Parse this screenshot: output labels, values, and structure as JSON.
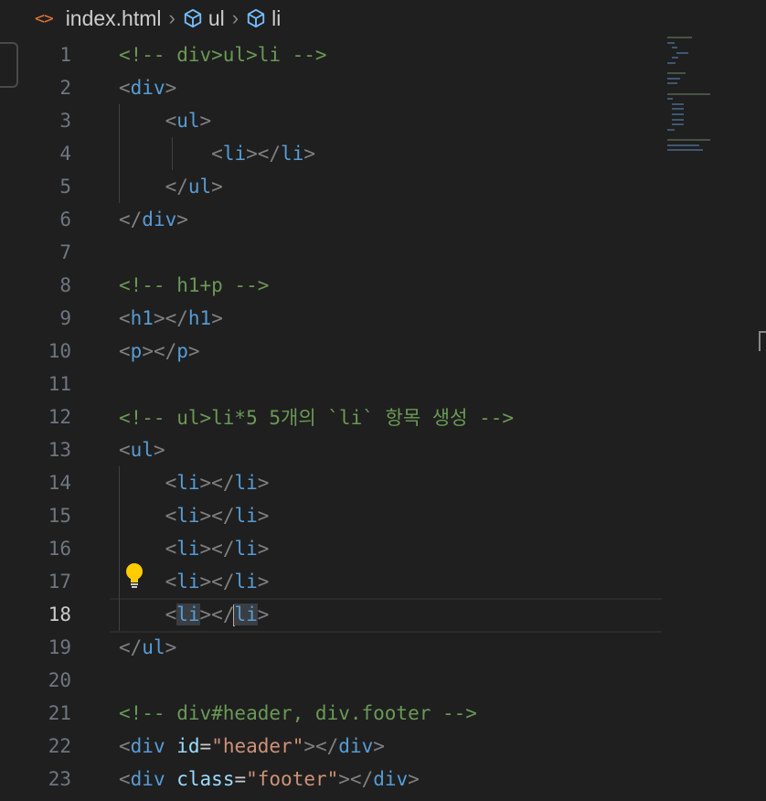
{
  "breadcrumb": {
    "file_icon": "<>",
    "file": "index.html",
    "items": [
      "ul",
      "li"
    ]
  },
  "editor": {
    "active_line": 18,
    "lines": [
      {
        "n": "1",
        "tokens": [
          [
            "cmt",
            "<!-- div>ul>li -->"
          ]
        ]
      },
      {
        "n": "2",
        "tokens": [
          [
            "br",
            "<"
          ],
          [
            "tag",
            "div"
          ],
          [
            "br",
            ">"
          ]
        ]
      },
      {
        "n": "3",
        "tokens": [
          [
            "sp",
            "    "
          ],
          [
            "br",
            "<"
          ],
          [
            "tag",
            "ul"
          ],
          [
            "br",
            ">"
          ]
        ]
      },
      {
        "n": "4",
        "tokens": [
          [
            "sp",
            "        "
          ],
          [
            "br",
            "<"
          ],
          [
            "tag",
            "li"
          ],
          [
            "br",
            "></"
          ],
          [
            "tag",
            "li"
          ],
          [
            "br",
            ">"
          ]
        ]
      },
      {
        "n": "5",
        "tokens": [
          [
            "sp",
            "    "
          ],
          [
            "br",
            "</"
          ],
          [
            "tag",
            "ul"
          ],
          [
            "br",
            ">"
          ]
        ]
      },
      {
        "n": "6",
        "tokens": [
          [
            "br",
            "</"
          ],
          [
            "tag",
            "div"
          ],
          [
            "br",
            ">"
          ]
        ]
      },
      {
        "n": "7",
        "tokens": []
      },
      {
        "n": "8",
        "tokens": [
          [
            "cmt",
            "<!-- h1+p -->"
          ]
        ]
      },
      {
        "n": "9",
        "tokens": [
          [
            "br",
            "<"
          ],
          [
            "tag",
            "h1"
          ],
          [
            "br",
            "></"
          ],
          [
            "tag",
            "h1"
          ],
          [
            "br",
            ">"
          ]
        ]
      },
      {
        "n": "10",
        "tokens": [
          [
            "br",
            "<"
          ],
          [
            "tag",
            "p"
          ],
          [
            "br",
            "></"
          ],
          [
            "tag",
            "p"
          ],
          [
            "br",
            ">"
          ]
        ]
      },
      {
        "n": "11",
        "tokens": []
      },
      {
        "n": "12",
        "tokens": [
          [
            "cmt",
            "<!-- ul>li*5 5개의 `li` 항목 생성 -->"
          ]
        ]
      },
      {
        "n": "13",
        "tokens": [
          [
            "br",
            "<"
          ],
          [
            "tag",
            "ul"
          ],
          [
            "br",
            ">"
          ]
        ]
      },
      {
        "n": "14",
        "tokens": [
          [
            "sp",
            "    "
          ],
          [
            "br",
            "<"
          ],
          [
            "tag",
            "li"
          ],
          [
            "br",
            "></"
          ],
          [
            "tag",
            "li"
          ],
          [
            "br",
            ">"
          ]
        ]
      },
      {
        "n": "15",
        "tokens": [
          [
            "sp",
            "    "
          ],
          [
            "br",
            "<"
          ],
          [
            "tag",
            "li"
          ],
          [
            "br",
            "></"
          ],
          [
            "tag",
            "li"
          ],
          [
            "br",
            ">"
          ]
        ]
      },
      {
        "n": "16",
        "tokens": [
          [
            "sp",
            "    "
          ],
          [
            "br",
            "<"
          ],
          [
            "tag",
            "li"
          ],
          [
            "br",
            "></"
          ],
          [
            "tag",
            "li"
          ],
          [
            "br",
            ">"
          ]
        ]
      },
      {
        "n": "17",
        "tokens": [
          [
            "sp",
            "    "
          ],
          [
            "br",
            "<"
          ],
          [
            "tag",
            "li"
          ],
          [
            "br",
            "></"
          ],
          [
            "tag",
            "li"
          ],
          [
            "br",
            ">"
          ]
        ]
      },
      {
        "n": "18",
        "tokens": [
          [
            "sp",
            "    "
          ],
          [
            "br",
            "<"
          ],
          [
            "tag-hl",
            "li"
          ],
          [
            "br",
            "></"
          ],
          [
            "cursor",
            ""
          ],
          [
            "tag-hl",
            "li"
          ],
          [
            "br",
            ">"
          ]
        ]
      },
      {
        "n": "19",
        "tokens": [
          [
            "br",
            "</"
          ],
          [
            "tag",
            "ul"
          ],
          [
            "br",
            ">"
          ]
        ]
      },
      {
        "n": "20",
        "tokens": []
      },
      {
        "n": "21",
        "tokens": [
          [
            "cmt",
            "<!-- div#header, div.footer -->"
          ]
        ]
      },
      {
        "n": "22",
        "tokens": [
          [
            "br",
            "<"
          ],
          [
            "tag",
            "div"
          ],
          [
            "sp",
            " "
          ],
          [
            "attr",
            "id"
          ],
          [
            "eq",
            "="
          ],
          [
            "str",
            "\"header\""
          ],
          [
            "br",
            "></"
          ],
          [
            "tag",
            "div"
          ],
          [
            "br",
            ">"
          ]
        ]
      },
      {
        "n": "23",
        "tokens": [
          [
            "br",
            "<"
          ],
          [
            "tag",
            "div"
          ],
          [
            "sp",
            " "
          ],
          [
            "attr",
            "class"
          ],
          [
            "eq",
            "="
          ],
          [
            "str",
            "\"footer\""
          ],
          [
            "br",
            "></"
          ],
          [
            "tag",
            "div"
          ],
          [
            "br",
            ">"
          ]
        ]
      }
    ]
  },
  "icons": {
    "file": "html-file-icon",
    "symbol": "cube-icon",
    "quickfix": "lightbulb-icon"
  },
  "colors": {
    "background": "#1f1f1f",
    "comment": "#6a9955",
    "tag": "#569cd6",
    "bracket": "#808080",
    "attribute": "#9cdcfe",
    "string": "#ce9178",
    "bulb": "#ffcc00"
  }
}
